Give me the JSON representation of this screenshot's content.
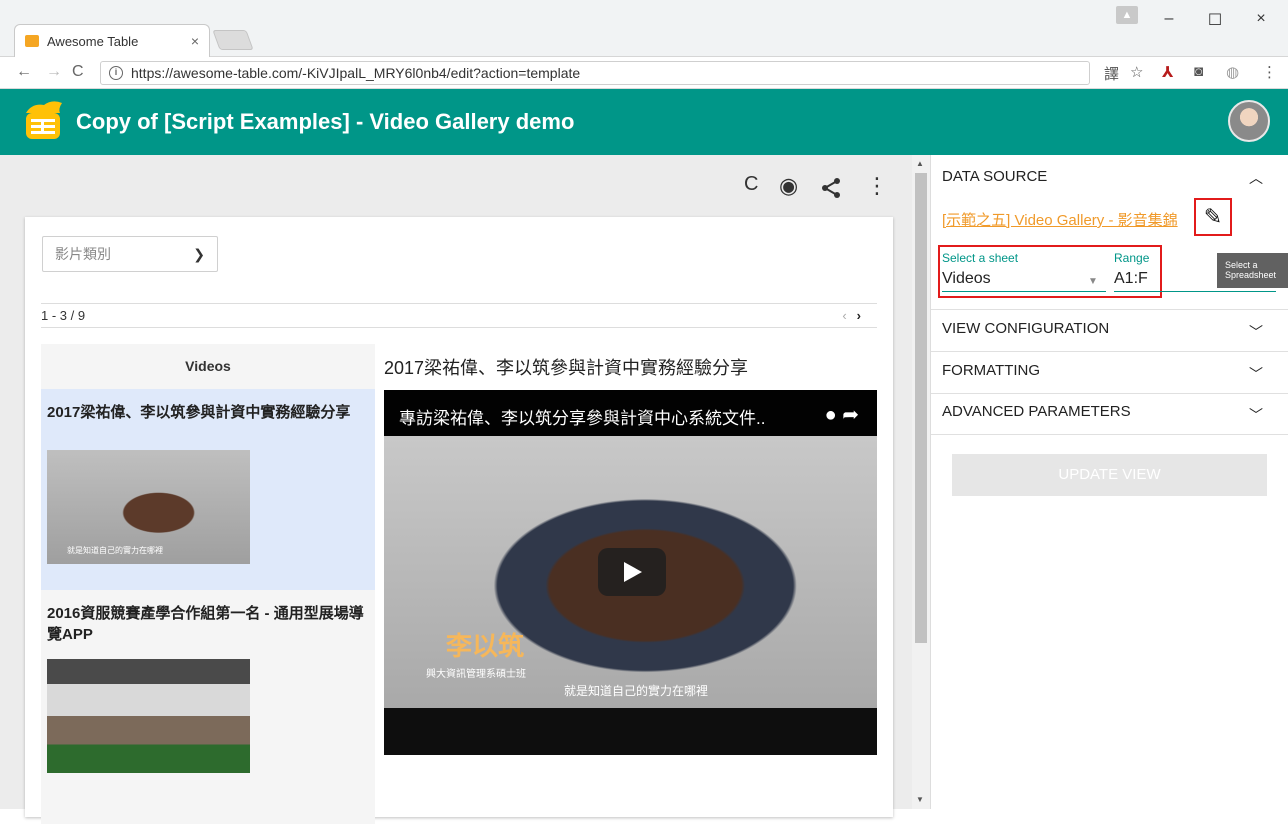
{
  "browser": {
    "tab_title": "Awesome Table",
    "tab_close": "×",
    "url": "https://awesome-table.com/-KiVJIpalL_MRY6l0nb4/edit?action=template",
    "window_controls": [
      "–",
      "☐",
      "×"
    ],
    "nav_icons": [
      "arrow-left-icon",
      "arrow-right-icon",
      "reload-icon"
    ]
  },
  "app": {
    "title": "Copy of [Script Examples] - Video Gallery demo",
    "accent": "#009688"
  },
  "preview": {
    "tools": [
      "reload-icon",
      "eye-icon",
      "share-icon",
      "more-vert-icon"
    ],
    "category_placeholder": "影片類別",
    "pager_text": "1 - 3 / 9",
    "list_header": "Videos",
    "items": [
      {
        "title": "2017梁祐偉、李以筑參與計資中實務經驗分享",
        "thumb_caption": "就是知道自己的實力在哪裡"
      },
      {
        "title": "2016資服競賽產學合作組第一名 - 通用型展場導覽APP",
        "thumb_caption": ""
      }
    ],
    "current_video_title": "2017梁祐偉、李以筑參與計資中實務經驗分享",
    "video": {
      "bar_title": "專訪梁祐偉、李以筑分享參與計資中心系統文件..",
      "name_overlay": "李以筑",
      "sub_overlay": "興大資訊管理系碩士班",
      "caption_overlay": "就是知道自己的實力在哪裡"
    }
  },
  "panel": {
    "data_source": {
      "heading": "DATA SOURCE",
      "sheet_link": "[示範之五] Video Gallery - 影音集錦",
      "select_sheet_label": "Select a sheet",
      "select_sheet_value": "Videos",
      "range_label": "Range",
      "range_value": "A1:F",
      "tooltip": "Select a Spreadsheet"
    },
    "sections": [
      "VIEW CONFIGURATION",
      "FORMATTING",
      "ADVANCED PARAMETERS"
    ],
    "update_button": "UPDATE VIEW",
    "highlight_color": "#e21b1b"
  }
}
